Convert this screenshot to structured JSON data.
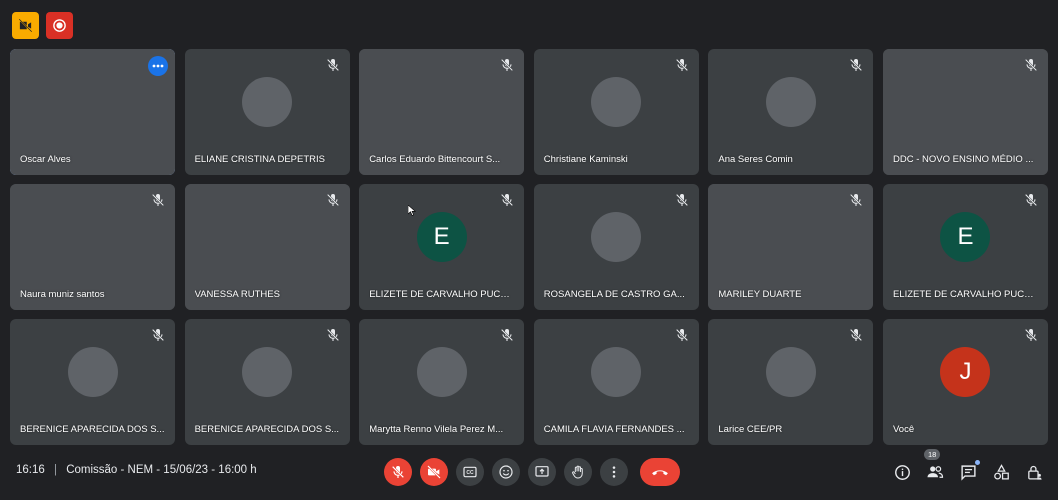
{
  "colors": {
    "background": "#202124",
    "tile": "#3c4043",
    "accent": "#8ab4f8",
    "danger": "#ea4335",
    "warning": "#f9ab00"
  },
  "top_badges": [
    {
      "icon": "video-off-icon",
      "color": "#f9ab00"
    },
    {
      "icon": "record-icon",
      "color": "#d93025"
    }
  ],
  "participants": [
    {
      "name": "Oscar Alves",
      "kind": "video",
      "mic": "on",
      "active": true
    },
    {
      "name": "ELIANE CRISTINA DEPETRIS",
      "kind": "avatar",
      "mic": "muted"
    },
    {
      "name": "Carlos Eduardo Bittencourt S...",
      "kind": "video",
      "mic": "muted"
    },
    {
      "name": "Christiane Kaminski",
      "kind": "avatar",
      "mic": "muted"
    },
    {
      "name": "Ana Seres Comin",
      "kind": "avatar",
      "mic": "muted"
    },
    {
      "name": "DDC - NOVO ENSINO MÉDIO ...",
      "kind": "video",
      "mic": "muted"
    },
    {
      "name": "Naura muniz santos",
      "kind": "video",
      "mic": "muted"
    },
    {
      "name": "VANESSA RUTHES",
      "kind": "video",
      "mic": "muted"
    },
    {
      "name": "ELIZETE DE CARVALHO PUCH...",
      "kind": "letter",
      "letter": "E",
      "letter_color": "#0d5344",
      "mic": "muted"
    },
    {
      "name": "ROSANGELA DE CASTRO GA...",
      "kind": "avatar",
      "mic": "muted"
    },
    {
      "name": "MARILEY DUARTE",
      "kind": "video",
      "mic": "muted"
    },
    {
      "name": "ELIZETE DE CARVALHO PUCH...",
      "kind": "letter",
      "letter": "E",
      "letter_color": "#0d5344",
      "mic": "muted"
    },
    {
      "name": "BERENICE APARECIDA DOS S...",
      "kind": "avatar",
      "mic": "muted"
    },
    {
      "name": "BERENICE APARECIDA DOS S...",
      "kind": "avatar",
      "mic": "muted"
    },
    {
      "name": "Marytta Renno Vilela Perez M...",
      "kind": "avatar",
      "mic": "muted"
    },
    {
      "name": "CAMILA FLAVIA FERNANDES ...",
      "kind": "avatar",
      "mic": "muted"
    },
    {
      "name": "Larice CEE/PR",
      "kind": "avatar",
      "mic": "muted"
    },
    {
      "name": "Você",
      "kind": "letter",
      "letter": "J",
      "letter_color": "#c5331b",
      "mic": "muted"
    }
  ],
  "meeting": {
    "time": "16:16",
    "separator": "|",
    "title": "Comissão - NEM - 15/06/23 - 16:00 h"
  },
  "controls": [
    {
      "name": "mic-toggle-button",
      "icon": "mic-off-icon",
      "style": "red"
    },
    {
      "name": "camera-toggle-button",
      "icon": "camera-off-icon",
      "style": "red"
    },
    {
      "name": "captions-button",
      "icon": "captions-icon",
      "style": "normal"
    },
    {
      "name": "reactions-button",
      "icon": "emoji-icon",
      "style": "normal"
    },
    {
      "name": "present-button",
      "icon": "present-icon",
      "style": "normal"
    },
    {
      "name": "raise-hand-button",
      "icon": "hand-icon",
      "style": "normal"
    },
    {
      "name": "more-options-button",
      "icon": "more-vert-icon",
      "style": "normal"
    }
  ],
  "hangup": {
    "icon": "phone-hangup-icon"
  },
  "right_controls": {
    "participant_count": "18"
  }
}
